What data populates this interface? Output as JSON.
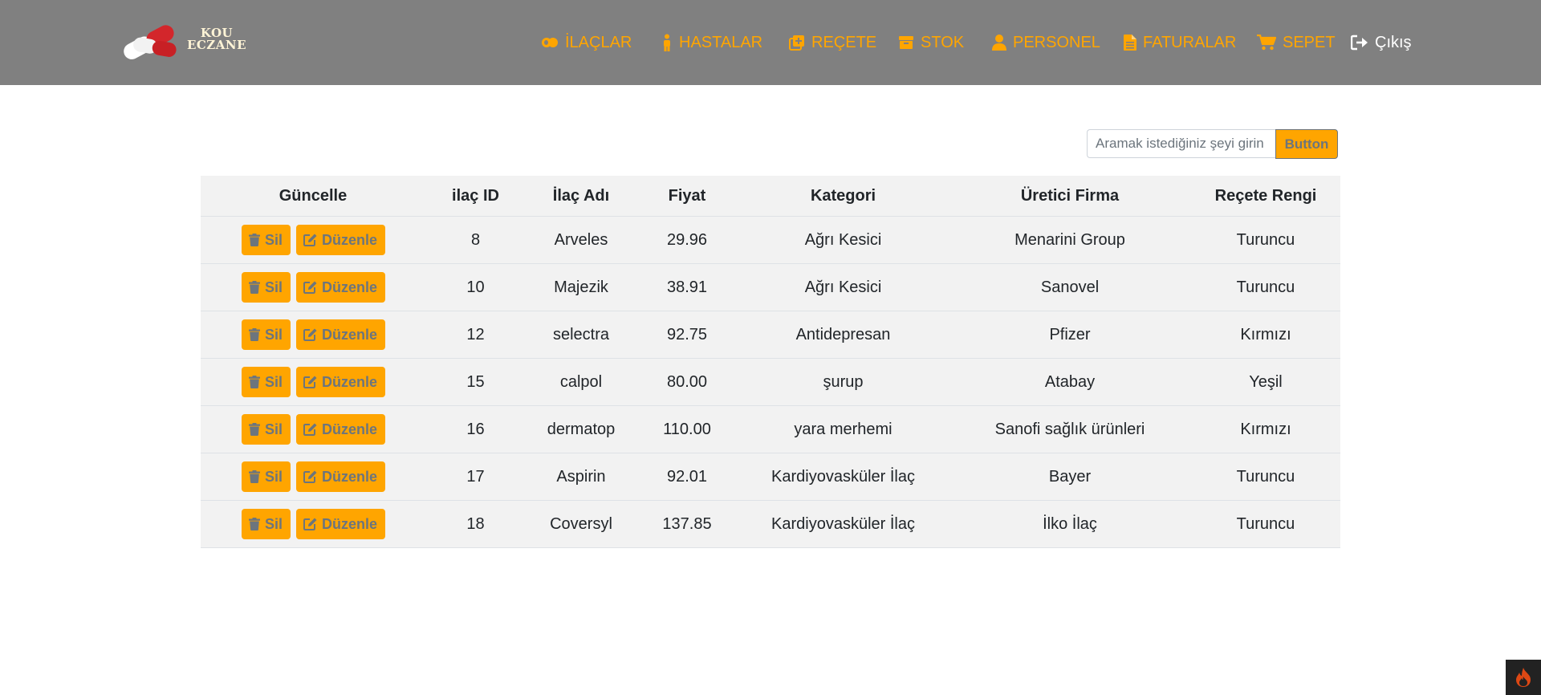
{
  "brand": {
    "line1": "KOU",
    "line2": "ECZANE"
  },
  "nav": [
    {
      "label": "İLAÇLAR",
      "icon": "pills-icon"
    },
    {
      "label": "HASTALAR",
      "icon": "person-standing-icon"
    },
    {
      "label": "REÇETE",
      "icon": "prescription-plus-icon"
    },
    {
      "label": "STOK",
      "icon": "box-icon"
    },
    {
      "label": "PERSONEL",
      "icon": "user-icon"
    },
    {
      "label": "FATURALAR",
      "icon": "document-icon"
    },
    {
      "label": "SEPET",
      "icon": "cart-icon"
    },
    {
      "label": "Çıkış",
      "icon": "logout-icon"
    }
  ],
  "search": {
    "placeholder": "Aramak istediğiniz şeyi girin",
    "button_label": "Button"
  },
  "table": {
    "headers": [
      "Güncelle",
      "ilaç ID",
      "İlaç Adı",
      "Fiyat",
      "Kategori",
      "Üretici Firma",
      "Reçete Rengi"
    ],
    "delete_label": "Sil",
    "edit_label": "Düzenle",
    "rows": [
      [
        "8",
        "Arveles",
        "29.96",
        "Ağrı Kesici",
        "Menarini Group",
        "Turuncu"
      ],
      [
        "10",
        "Majezik",
        "38.91",
        "Ağrı Kesici",
        "Sanovel",
        "Turuncu"
      ],
      [
        "12",
        "selectra",
        "92.75",
        "Antidepresan",
        "Pfizer",
        "Kırmızı"
      ],
      [
        "15",
        "calpol",
        "80.00",
        "şurup",
        "Atabay",
        "Yeşil"
      ],
      [
        "16",
        "dermatop",
        "110.00",
        "yara merhemi",
        "Sanofi sağlık ürünleri",
        "Kırmızı"
      ],
      [
        "17",
        "Aspirin",
        "92.01",
        "Kardiyovasküler İlaç",
        "Bayer",
        "Turuncu"
      ],
      [
        "18",
        "Coversyl",
        "137.85",
        "Kardiyovasküler İlaç",
        "İlko İlaç",
        "Turuncu"
      ]
    ]
  },
  "colors": {
    "navbar": "#808080",
    "accent": "#ffa500",
    "table_bg": "#f2f2f2"
  }
}
